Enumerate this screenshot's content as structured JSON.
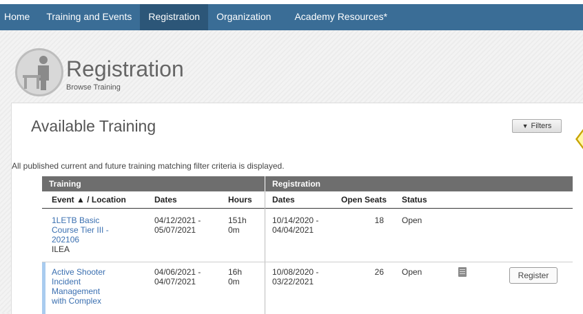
{
  "nav": {
    "items": [
      {
        "label": "Home"
      },
      {
        "label": "Training and Events"
      },
      {
        "label": "Registration"
      },
      {
        "label": "Organization"
      },
      {
        "label": "Academy Resources*"
      }
    ]
  },
  "header": {
    "title": "Registration",
    "subtitle": "Browse Training",
    "icon": "person-at-desk-icon"
  },
  "panel": {
    "title": "Available Training",
    "filters_label": "Filters",
    "description": "All published current and future training matching filter criteria is displayed."
  },
  "table": {
    "groups": [
      "Training",
      "Registration"
    ],
    "columns": {
      "event": "Event ▲ / Location",
      "dates": "Dates",
      "hours": "Hours",
      "reg_dates": "Dates",
      "open_seats": "Open Seats",
      "status": "Status"
    },
    "rows": [
      {
        "event_l1": "1LETB Basic",
        "event_l2": "Course Tier III -",
        "event_l3": "202106",
        "location": "ILEA",
        "dates_l1": "04/12/2021 -",
        "dates_l2": "05/07/2021",
        "hours_l1": "151h",
        "hours_l2": "0m",
        "reg_l1": "10/14/2020 -",
        "reg_l2": "04/04/2021",
        "open_seats": "18",
        "status": "Open"
      },
      {
        "event_l1": "Active Shooter",
        "event_l2": "Incident",
        "event_l3": "Management",
        "event_l4": "with Complex",
        "dates_l1": "04/06/2021 -",
        "dates_l2": "04/07/2021",
        "hours_l1": "16h",
        "hours_l2": "0m",
        "reg_l1": "10/08/2020 -",
        "reg_l2": "03/22/2021",
        "open_seats": "26",
        "status": "Open",
        "action": "Register"
      }
    ]
  },
  "colors": {
    "nav": "#3a6d96",
    "nav_active": "#2c5678",
    "link": "#3a6fb0",
    "group_header": "#6e6e6e",
    "row_accent": "#a9ccef"
  }
}
